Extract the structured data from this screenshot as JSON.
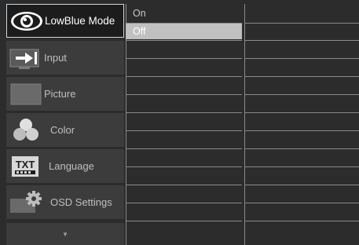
{
  "menu": {
    "items": [
      {
        "label": "LowBlue Mode",
        "icon": "eye-icon",
        "selected": true
      },
      {
        "label": "Input",
        "icon": "input-arrow-icon",
        "selected": false
      },
      {
        "label": "Picture",
        "icon": "picture-icon",
        "selected": false
      },
      {
        "label": "Color",
        "icon": "color-circles-icon",
        "selected": false
      },
      {
        "label": "Language",
        "icon": "txt-language-icon",
        "selected": false
      },
      {
        "label": "OSD Settings",
        "icon": "osd-settings-gear-icon",
        "selected": false
      }
    ],
    "scroll_icon": "chevron-down-icon"
  },
  "options": {
    "items": [
      {
        "label": "On",
        "selected": false
      },
      {
        "label": "Off",
        "selected": true
      }
    ]
  },
  "colors": {
    "background": "#2c2c2c",
    "menu_item": "#3c3c3c",
    "selected_border": "#cfd6dc",
    "selected_option": "#c0c0c0"
  }
}
